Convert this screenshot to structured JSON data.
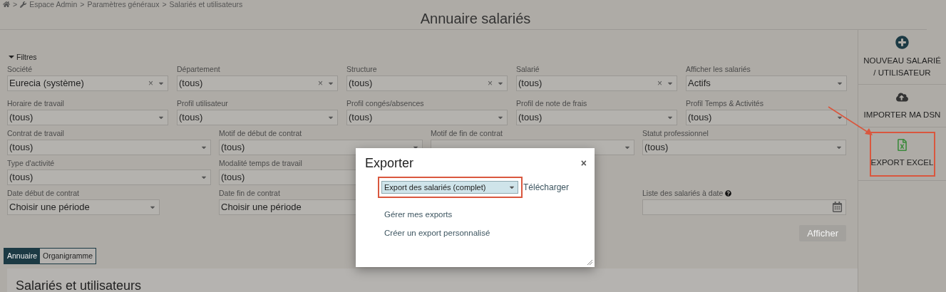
{
  "breadcrumb": [
    {
      "kind": "home"
    },
    {
      "kind": "separator",
      "text": ">"
    },
    {
      "kind": "admin",
      "text": "Espace Admin"
    },
    {
      "kind": "separator",
      "text": ">"
    },
    {
      "kind": "link",
      "text": "Paramètres généraux"
    },
    {
      "kind": "separator",
      "text": ">"
    },
    {
      "kind": "link",
      "text": "Salariés et utilisateurs"
    }
  ],
  "page_title": "Annuaire salariés",
  "filters": {
    "label": "Filtres",
    "expanded": true,
    "rows": [
      {
        "fields": [
          {
            "kind": "select",
            "label": "Société",
            "value": "Eurecia (système)",
            "clear": "×"
          },
          {
            "kind": "select",
            "label": "Département",
            "value": "(tous)",
            "clear": "×"
          },
          {
            "kind": "select",
            "label": "Structure",
            "value": "(tous)",
            "clear": "×"
          },
          {
            "kind": "select",
            "label": "Salarié",
            "value": "(tous)",
            "clear": "×"
          },
          {
            "kind": "select",
            "label": "Afficher les salariés",
            "value": "Actifs"
          }
        ]
      },
      {
        "fields": [
          {
            "kind": "select",
            "label": "Horaire de travail",
            "value": "(tous)"
          },
          {
            "kind": "select",
            "label": "Profil utilisateur",
            "value": "(tous)"
          },
          {
            "kind": "select",
            "label": "Profil congés/absences",
            "value": "(tous)"
          },
          {
            "kind": "select",
            "label": "Profil de note de frais",
            "value": "(tous)"
          },
          {
            "kind": "select",
            "label": "Profil Temps & Activités",
            "value": "(tous)"
          }
        ]
      },
      {
        "fields": [
          {
            "kind": "select",
            "label": "Contrat de travail",
            "value": "(tous)"
          },
          {
            "kind": "select",
            "label": "Motif de début de contrat",
            "value": "(tous)"
          },
          {
            "kind": "select",
            "label": "Motif de fin de contrat"
          },
          {
            "kind": "select",
            "label": "Statut professionnel",
            "value": "(tous)"
          }
        ]
      },
      {
        "fields": [
          {
            "kind": "select",
            "label": "Type d'activité",
            "value": "(tous)"
          },
          {
            "kind": "select",
            "label": "Modalité temps de travail",
            "value": "(tous)"
          },
          {
            "kind": "empty"
          },
          {
            "kind": "empty"
          }
        ]
      },
      {
        "fields": [
          {
            "kind": "period",
            "label": "Date début de contrat",
            "value": "Choisir une période"
          },
          {
            "kind": "period",
            "label": "Date fin de contrat",
            "value": "Choisir une période"
          },
          {
            "kind": "empty"
          },
          {
            "kind": "date",
            "label": "Liste des salariés à date",
            "help": true
          }
        ]
      }
    ],
    "submit": {
      "label": "Afficher",
      "disabled": true
    }
  },
  "view_tabs": [
    {
      "label": "Annuaire",
      "selected": true
    },
    {
      "label": "Organigramme",
      "selected": false
    }
  ],
  "section_title": "Salariés et utilisateurs",
  "actions": [
    {
      "kind": "new",
      "label": "NOUVEAU SALARIÉ / UTILISATEUR",
      "highlighted": false
    },
    {
      "kind": "import",
      "label": "IMPORTER MA DSN",
      "highlighted": false
    },
    {
      "kind": "excel",
      "label": "EXPORT EXCEL",
      "highlighted": true
    }
  ],
  "dialog": {
    "title": "Exporter",
    "close": "×",
    "select": {
      "value": "Export des salariés (complet)",
      "highlighted": true
    },
    "download": "Télécharger",
    "links": [
      "Gérer mes exports",
      "Créer un export personnalisé"
    ]
  }
}
